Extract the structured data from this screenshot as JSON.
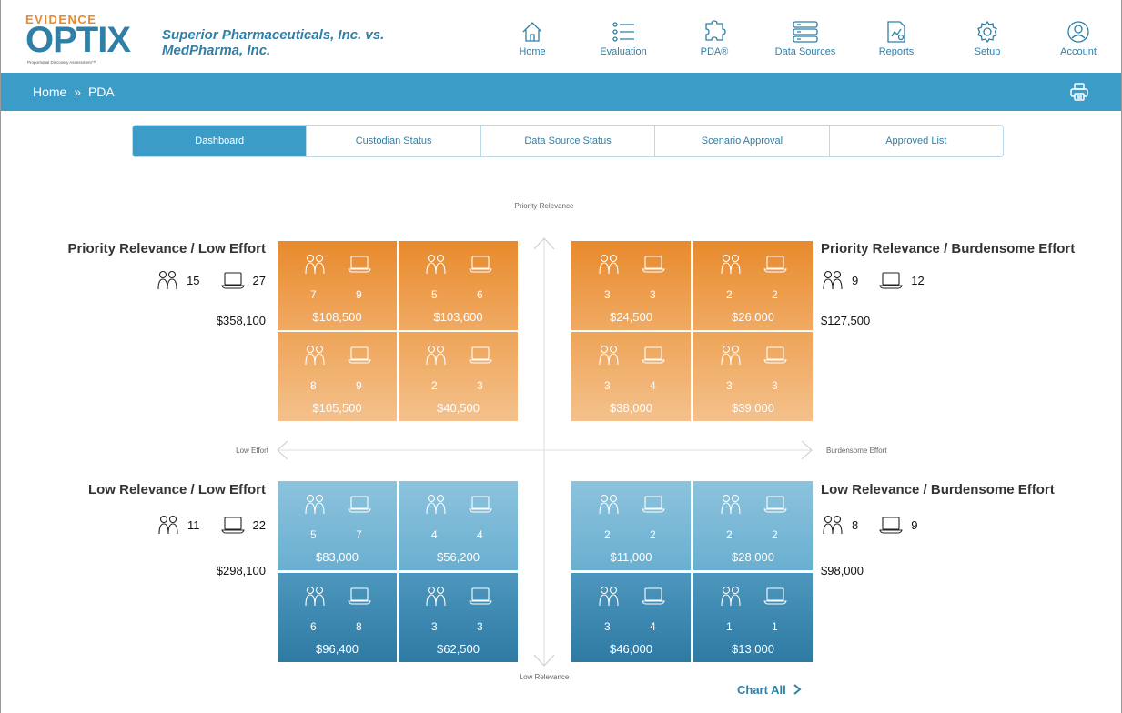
{
  "brand": {
    "top": "EVIDENCE",
    "main": "OPTIX",
    "tagline": "Proportional Discovery Assessment™"
  },
  "case_title": "Superior Pharmaceuticals, Inc. vs. MedPharma, Inc.",
  "nav": [
    {
      "label": "Home",
      "icon": "home-icon"
    },
    {
      "label": "Evaluation",
      "icon": "list-icon"
    },
    {
      "label": "PDA®",
      "icon": "puzzle-icon"
    },
    {
      "label": "Data Sources",
      "icon": "server-icon"
    },
    {
      "label": "Reports",
      "icon": "report-icon"
    },
    {
      "label": "Setup",
      "icon": "gear-icon"
    },
    {
      "label": "Account",
      "icon": "user-icon"
    }
  ],
  "breadcrumb": {
    "home": "Home",
    "sep": "»",
    "current": "PDA"
  },
  "tabs": [
    {
      "label": "Dashboard",
      "active": true
    },
    {
      "label": "Custodian Status",
      "active": false
    },
    {
      "label": "Data Source Status",
      "active": false
    },
    {
      "label": "Scenario Approval",
      "active": false
    },
    {
      "label": "Approved List",
      "active": false
    }
  ],
  "axes": {
    "top": "Priority Relevance",
    "bottom": "Low Relevance",
    "left": "Low Effort",
    "right": "Burdensome Effort"
  },
  "quadrants": {
    "prio_low": {
      "title": "Priority Relevance / Low Effort",
      "custodians": "15",
      "sources": "27",
      "cost": "$358,100"
    },
    "prio_burden": {
      "title": "Priority Relevance / Burdensome Effort",
      "custodians": "9",
      "sources": "12",
      "cost": "$127,500"
    },
    "low_low": {
      "title": "Low Relevance / Low Effort",
      "custodians": "11",
      "sources": "22",
      "cost": "$298,100"
    },
    "low_burden": {
      "title": "Low Relevance / Burdensome Effort",
      "custodians": "8",
      "sources": "9",
      "cost": "$98,000"
    }
  },
  "cells": [
    {
      "c": "7",
      "s": "9",
      "amt": "$108,500"
    },
    {
      "c": "5",
      "s": "6",
      "amt": "$103,600"
    },
    {
      "c": "3",
      "s": "3",
      "amt": "$24,500"
    },
    {
      "c": "2",
      "s": "2",
      "amt": "$26,000"
    },
    {
      "c": "8",
      "s": "9",
      "amt": "$105,500"
    },
    {
      "c": "2",
      "s": "3",
      "amt": "$40,500"
    },
    {
      "c": "3",
      "s": "4",
      "amt": "$38,000"
    },
    {
      "c": "3",
      "s": "3",
      "amt": "$39,000"
    },
    {
      "c": "5",
      "s": "7",
      "amt": "$83,000"
    },
    {
      "c": "4",
      "s": "4",
      "amt": "$56,200"
    },
    {
      "c": "2",
      "s": "2",
      "amt": "$11,000"
    },
    {
      "c": "2",
      "s": "2",
      "amt": "$28,000"
    },
    {
      "c": "6",
      "s": "8",
      "amt": "$96,400"
    },
    {
      "c": "3",
      "s": "3",
      "amt": "$62,500"
    },
    {
      "c": "3",
      "s": "4",
      "amt": "$46,000"
    },
    {
      "c": "1",
      "s": "1",
      "amt": "$13,000"
    }
  ],
  "chart_all": "Chart All"
}
